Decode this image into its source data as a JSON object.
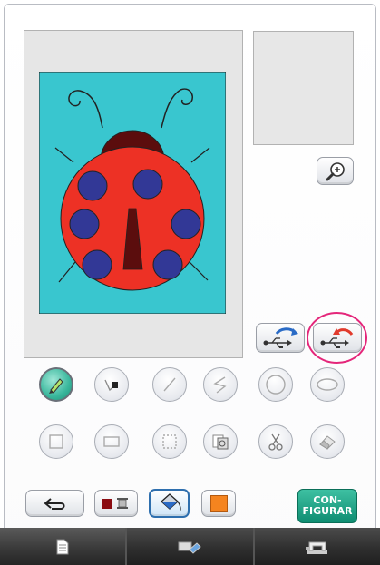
{
  "screen": "my-design-center-drawing",
  "canvas": {
    "image": "ladybug-drawing",
    "colors": {
      "background": "#39c6cf",
      "body": "#ed3125",
      "head": "#5b0d0d",
      "spots": "#323896",
      "stripe": "#5b0d0d"
    }
  },
  "zoom_button": {
    "icon": "magnifier-plus-icon"
  },
  "usb_buttons": [
    {
      "icon": "usb-save-icon",
      "arrow_color": "#2a6bc6"
    },
    {
      "icon": "usb-load-icon",
      "arrow_color": "#e13a2c"
    }
  ],
  "tools_row1": [
    {
      "name": "pen",
      "active": true
    },
    {
      "name": "line-type"
    },
    {
      "name": "straight-line"
    },
    {
      "name": "zigzag-line"
    },
    {
      "name": "circle"
    },
    {
      "name": "ellipse"
    }
  ],
  "tools_row2": [
    {
      "name": "square"
    },
    {
      "name": "rectangle"
    },
    {
      "name": "select-area"
    },
    {
      "name": "stamp"
    },
    {
      "name": "scissors"
    },
    {
      "name": "eraser"
    }
  ],
  "bottom": {
    "back": {
      "icon": "undo-arrow-icon"
    },
    "line_color": {
      "swatch": "#8b0d12"
    },
    "fill_active": true,
    "area_color": {
      "swatch": "#f5841f"
    },
    "config": {
      "line1": "CON-",
      "line2": "FIGURAR"
    }
  },
  "tabs": [
    {
      "icon": "document-icon"
    },
    {
      "icon": "eraser-tab-icon"
    },
    {
      "icon": "sewing-machine-icon"
    }
  ]
}
